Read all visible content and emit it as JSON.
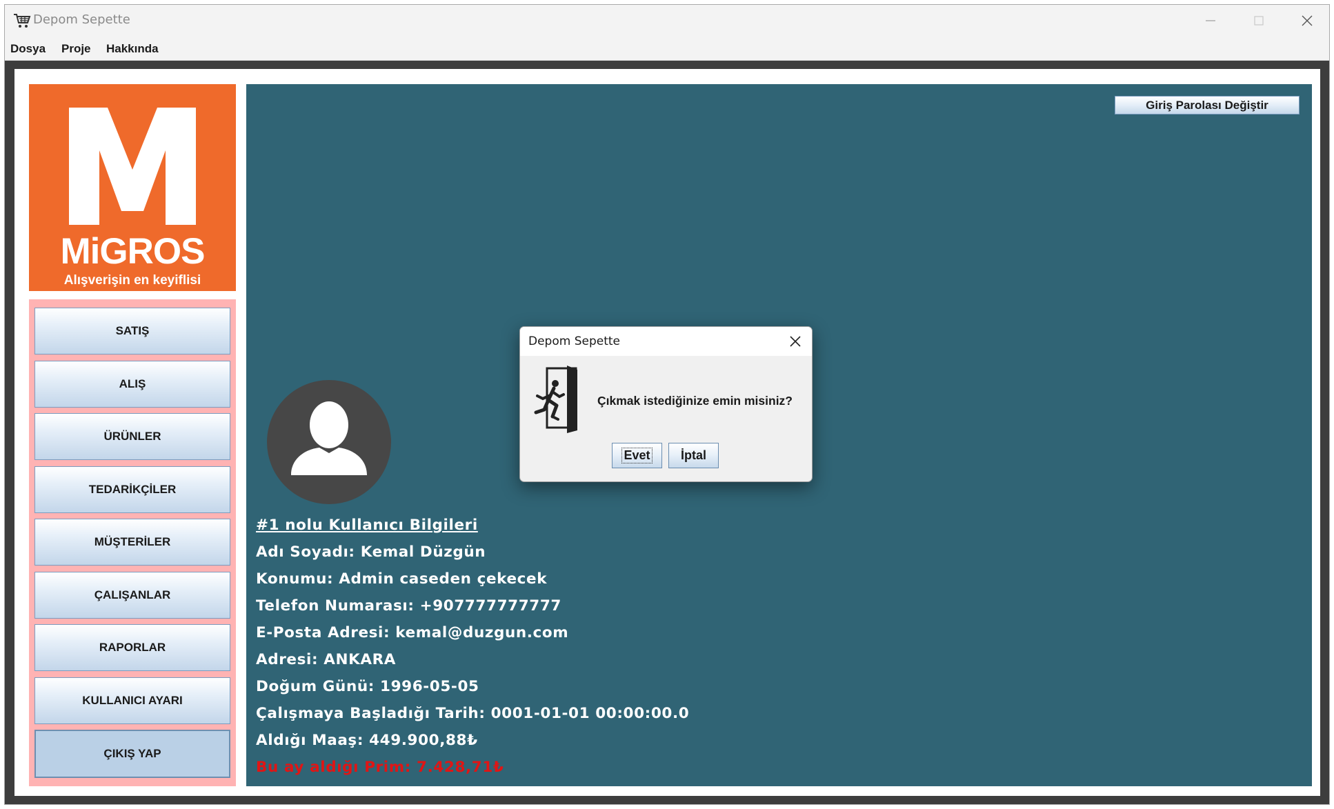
{
  "window": {
    "title": "Depom Sepette",
    "icons": {
      "app": "shopping-cart-icon",
      "minimize": "minimize-icon",
      "maximize": "maximize-icon",
      "close": "close-icon"
    }
  },
  "menu": [
    "Dosya",
    "Proje",
    "Hakkında"
  ],
  "logo": {
    "brand": "MiGROS",
    "slogan": "Alışverişin en keyiflisi"
  },
  "nav": [
    "SATIŞ",
    "ALIŞ",
    "ÜRÜNLER",
    "TEDARİKÇİLER",
    "MÜŞTERİLER",
    "ÇALIŞANLAR",
    "RAPORLAR",
    "KULLANICI AYARI",
    "ÇIKIŞ YAP"
  ],
  "password_button": "Giriş Parolası Değiştir",
  "user": {
    "heading": "#1 nolu Kullanıcı Bilgileri",
    "name": "Adı Soyadı: Kemal Düzgün",
    "position": "Konumu: Admin caseden çekecek",
    "phone": "Telefon Numarası: +907777777777",
    "email": "E-Posta Adresi: kemal@duzgun.com",
    "address": "Adresi: ANKARA",
    "birthday": "Doğum Günü: 1996-05-05",
    "start_date": "Çalışmaya Başladığı Tarih: 0001-01-01 00:00:00.0",
    "salary": "Aldığı Maaş: 449.900,88₺",
    "bonus": "Bu ay aldığı Prim: 7.428,71₺"
  },
  "dialog": {
    "title": "Depom Sepette",
    "message": "Çıkmak istediğinize emin misiniz?",
    "yes": "Evet",
    "cancel": "İptal",
    "icon": "exit-door-icon"
  },
  "colors": {
    "panel": "#306475",
    "logo_bg": "#ef6a2b",
    "nav_bg": "#ffb3b3",
    "bonus_text": "#e01515"
  }
}
